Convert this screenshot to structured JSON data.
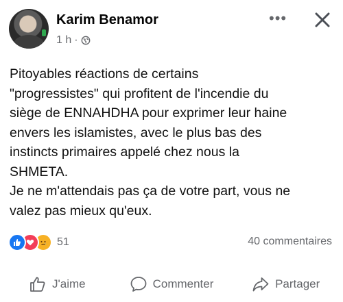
{
  "post": {
    "author": "Karim Benamor",
    "time": "1 h",
    "separator": "·",
    "more_label": "•••",
    "text_lines": [
      "Pitoyables réactions de certains",
      "\"progressistes\" qui profitent de l'incendie du",
      "siège de ENNAHDHA pour exprimer leur haine",
      "envers les islamistes, avec le plus bas des",
      "instincts primaires appelé chez nous la",
      "SHMETA.",
      "Je ne m'attendais pas ça de votre part, vous ne",
      "valez pas mieux qu'eux."
    ]
  },
  "stats": {
    "reactions_count": "51",
    "comments": "40 commentaires"
  },
  "actions": {
    "like": "J'aime",
    "comment": "Commenter",
    "share": "Partager"
  },
  "colors": {
    "like_blue": "#1877f2",
    "love_red": "#f33e58",
    "sad_yellow": "#f7b125",
    "secondary_text": "#65676b"
  },
  "icons": {
    "privacy": "globe-icon",
    "close": "close-icon",
    "like": "thumbs-up-icon",
    "comment": "comment-bubble-icon",
    "share": "share-arrow-icon"
  }
}
